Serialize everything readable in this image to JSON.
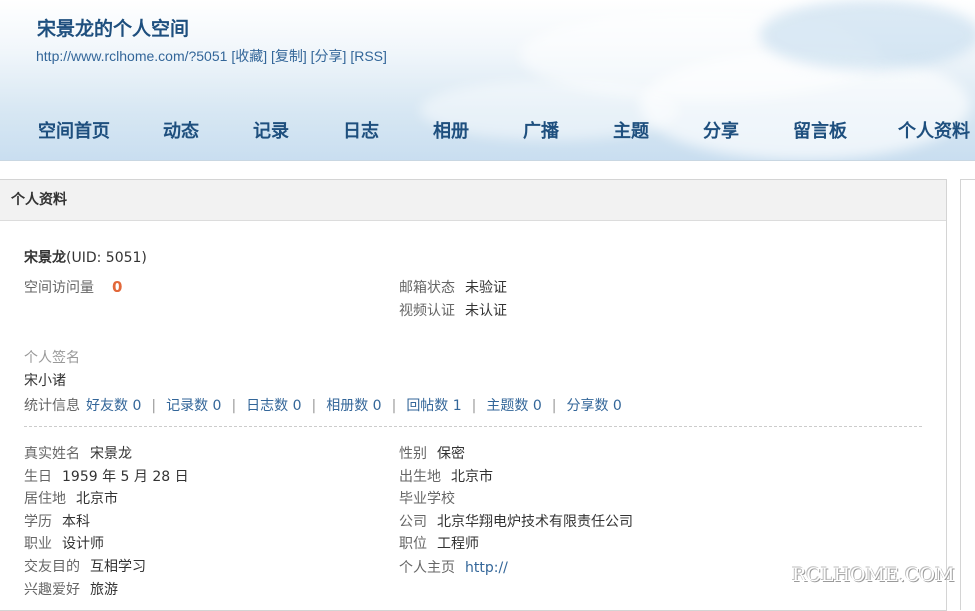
{
  "header": {
    "title": "宋景龙的个人空间",
    "url": "http://www.rclhome.com/?5051",
    "actions": [
      "[收藏]",
      "[复制]",
      "[分享]",
      "[RSS]"
    ]
  },
  "nav": [
    "空间首页",
    "动态",
    "记录",
    "日志",
    "相册",
    "广播",
    "主题",
    "分享",
    "留言板",
    "个人资料"
  ],
  "panel": {
    "title": "个人资料",
    "name": "宋景龙",
    "uid": "(UID: 5051)",
    "visits_label": "空间访问量",
    "visits_value": "0",
    "email_label": "邮箱状态",
    "email_value": "未验证",
    "video_label": "视频认证",
    "video_value": "未认证",
    "signature_label": "个人签名",
    "signature_value": "宋小诸",
    "stats_label": "统计信息",
    "stats": [
      "好友数 0",
      "记录数 0",
      "日志数 0",
      "相册数 0",
      "回帖数 1",
      "主题数 0",
      "分享数 0"
    ],
    "left_fields": [
      {
        "label": "真实姓名",
        "value": "宋景龙"
      },
      {
        "label": "生日",
        "value": "1959 年 5 月 28 日"
      },
      {
        "label": "居住地",
        "value": "北京市"
      },
      {
        "label": "学历",
        "value": "本科"
      },
      {
        "label": "职业",
        "value": "设计师"
      },
      {
        "label": "交友目的",
        "value": "互相学习"
      },
      {
        "label": "兴趣爱好",
        "value": "旅游"
      }
    ],
    "right_fields": [
      {
        "label": "性别",
        "value": "保密"
      },
      {
        "label": "出生地",
        "value": "北京市"
      },
      {
        "label": "毕业学校",
        "value": ""
      },
      {
        "label": "公司",
        "value": "北京华翔电炉技术有限责任公司"
      },
      {
        "label": "职位",
        "value": "工程师"
      },
      {
        "label": "个人主页",
        "value": "http://"
      }
    ]
  },
  "watermark": "RCLHOME.COM"
}
